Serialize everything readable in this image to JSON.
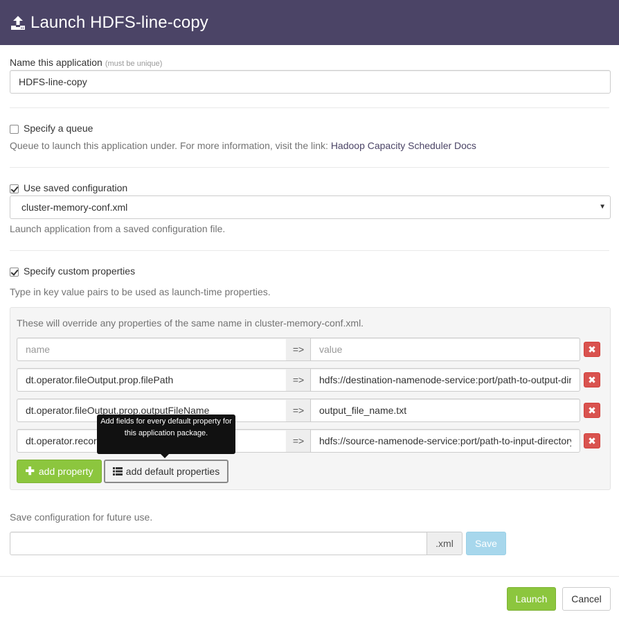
{
  "header": {
    "title": "Launch HDFS-line-copy",
    "icon": "upload-icon"
  },
  "name_section": {
    "label": "Name this application",
    "hint": "(must be unique)",
    "value": "HDFS-line-copy"
  },
  "queue_section": {
    "checkbox_label": "Specify a queue",
    "checked": false,
    "help_text": "Queue to launch this application under. For more information, visit the link:",
    "link_text": "Hadoop Capacity Scheduler Docs"
  },
  "saved_config_section": {
    "checkbox_label": "Use saved configuration",
    "checked": true,
    "selected_value": "cluster-memory-conf.xml",
    "help_text": "Launch application from a saved configuration file."
  },
  "custom_props_section": {
    "checkbox_label": "Specify custom properties",
    "checked": true,
    "help_text": "Type in key value pairs to be used as launch-time properties.",
    "override_note": "These will override any properties of the same name in cluster-memory-conf.xml.",
    "separator": "=>",
    "rows": [
      {
        "name": "",
        "value": "",
        "name_placeholder": "name",
        "value_placeholder": "value"
      },
      {
        "name": "dt.operator.fileOutput.prop.filePath",
        "value": "hdfs://destination-namenode-service:port/path-to-output-dir"
      },
      {
        "name": "dt.operator.fileOutput.prop.outputFileName",
        "value": "output_file_name.txt"
      },
      {
        "name": "dt.operator.recordReader.prop.files",
        "value": "hdfs://source-namenode-service:port/path-to-input-directory"
      }
    ],
    "add_property_label": "add property",
    "add_default_label": "add default properties",
    "tooltip": "Add fields for every default property for this application package."
  },
  "save_config_section": {
    "label": "Save configuration for future use.",
    "value": "",
    "extension": ".xml",
    "save_label": "Save"
  },
  "footer": {
    "launch_label": "Launch",
    "cancel_label": "Cancel"
  },
  "colors": {
    "header_bg": "#4b4466",
    "green": "#8cc63e",
    "danger": "#d9534f",
    "save_disabled": "#a7d7ec"
  }
}
